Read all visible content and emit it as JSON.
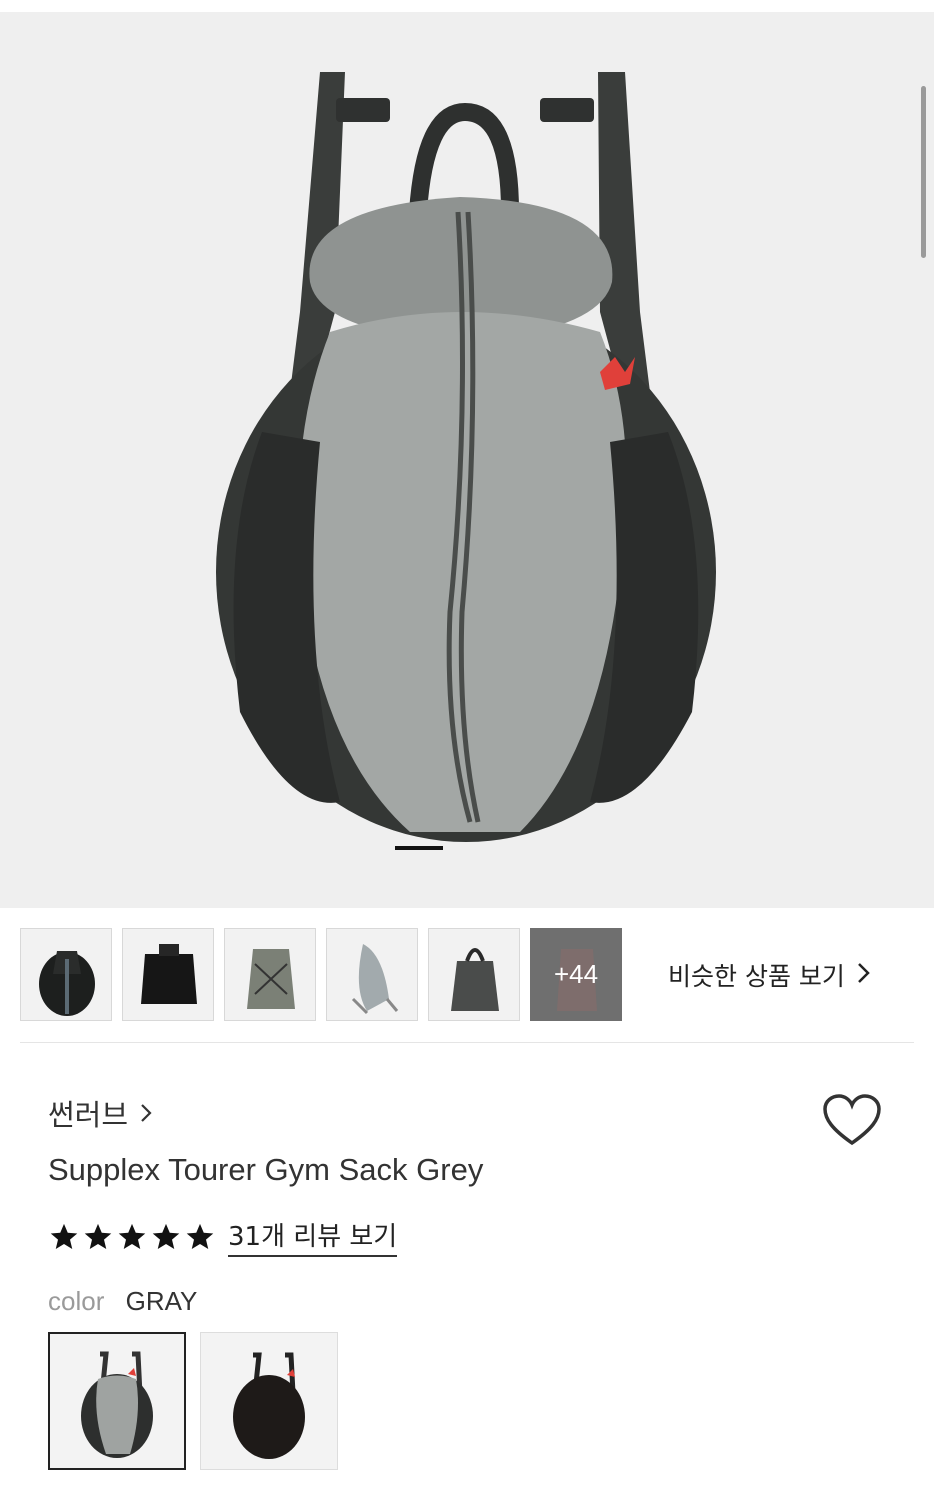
{
  "similar_products": {
    "label": "비슷한 상품 보기"
  },
  "thumbnails": {
    "more_label": "+44"
  },
  "product": {
    "brand": "썬러브",
    "title": "Supplex Tourer Gym Sack Grey",
    "rating": 5,
    "review_link": "31개 리뷰 보기",
    "color_label": "color",
    "color_value": "GRAY"
  },
  "colors": {
    "accent": "#222222",
    "star": "#111111"
  }
}
